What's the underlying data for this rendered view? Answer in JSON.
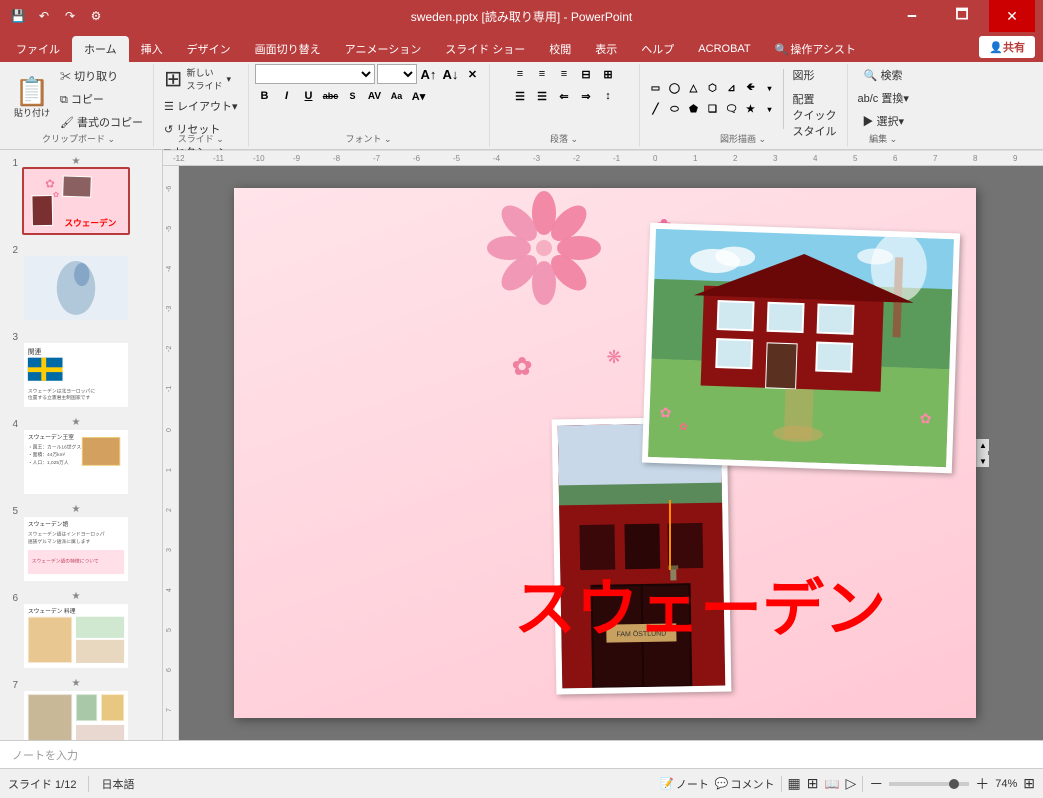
{
  "titlebar": {
    "title": "sweden.pptx [読み取り専用] - PowerPoint",
    "save_icon": "💾",
    "undo_icon": "↶",
    "redo_icon": "↷",
    "settings_icon": "⚙",
    "minimize": "🗕",
    "maximize": "🗖",
    "close": "✕"
  },
  "tabs": {
    "items": [
      "ファイル",
      "ホーム",
      "挿入",
      "デザイン",
      "画面切り替え",
      "アニメーション",
      "スライド ショー",
      "校閲",
      "表示",
      "ヘルプ",
      "ACROBAT",
      "操作アシスト"
    ],
    "active": "ホーム",
    "share_label": "共有"
  },
  "ribbon": {
    "clipboard_label": "クリップボード",
    "clipboard_expand": "⌄",
    "paste_label": "貼り付け",
    "cut_icon": "✂",
    "cut_label": "切り取り",
    "copy_icon": "⧉",
    "copy_label": "コピー",
    "format_icon": "🖌",
    "format_label": "書式のコピー",
    "slide_label": "スライド",
    "slide_expand": "⌄",
    "new_slide_label": "新しい\nスライド",
    "layout_label": "レイアウト▾",
    "reset_label": "リセット",
    "section_label": "□ セクション▾",
    "font_label": "フォント",
    "font_expand": "⌄",
    "font_name": "",
    "font_size": "",
    "bold": "B",
    "italic": "I",
    "underline": "U",
    "strikethrough": "abc",
    "fontcolor_label": "A▾",
    "increase_font": "A↑",
    "decrease_font": "A↓",
    "paragraph_label": "段落",
    "paragraph_expand": "⌄",
    "drawing_label": "図形描画",
    "drawing_expand": "⌄",
    "quick_style_label": "クイック\nスタイル",
    "shapes_label": "図形",
    "arrange_label": "配置",
    "edit_label": "編集",
    "edit_expand": "⌄",
    "search_label": "検索",
    "replace_label": "ab/c 置換▾",
    "select_label": "▶ 選択▾"
  },
  "slides": [
    {
      "num": "1",
      "star": "★",
      "active": true,
      "bg": "pink",
      "label": "slide1"
    },
    {
      "num": "2",
      "star": "",
      "active": false,
      "bg": "blue",
      "label": "slide2"
    },
    {
      "num": "3",
      "star": "",
      "active": false,
      "bg": "white",
      "label": "slide3"
    },
    {
      "num": "4",
      "star": "★",
      "active": false,
      "bg": "white",
      "label": "slide4"
    },
    {
      "num": "5",
      "star": "★",
      "active": false,
      "bg": "white",
      "label": "slide5"
    },
    {
      "num": "6",
      "star": "★",
      "active": false,
      "bg": "white",
      "label": "slide6"
    },
    {
      "num": "7",
      "star": "★",
      "active": false,
      "bg": "white",
      "label": "slide7"
    }
  ],
  "slide": {
    "title_text": "スウェーデン",
    "notes_placeholder": "ノートを入力"
  },
  "statusbar": {
    "slide_info": "スライド 1/12",
    "language": "日本語",
    "notes_btn": "📝 ノート",
    "comments_btn": "💬 コメント",
    "normal_view": "▦",
    "slide_sorter": "⊞",
    "reading_view": "📖",
    "slide_show": "▷",
    "zoom_level": "74%",
    "fit_btn": "⊞",
    "zoom_minus": "－",
    "zoom_plus": "＋"
  }
}
